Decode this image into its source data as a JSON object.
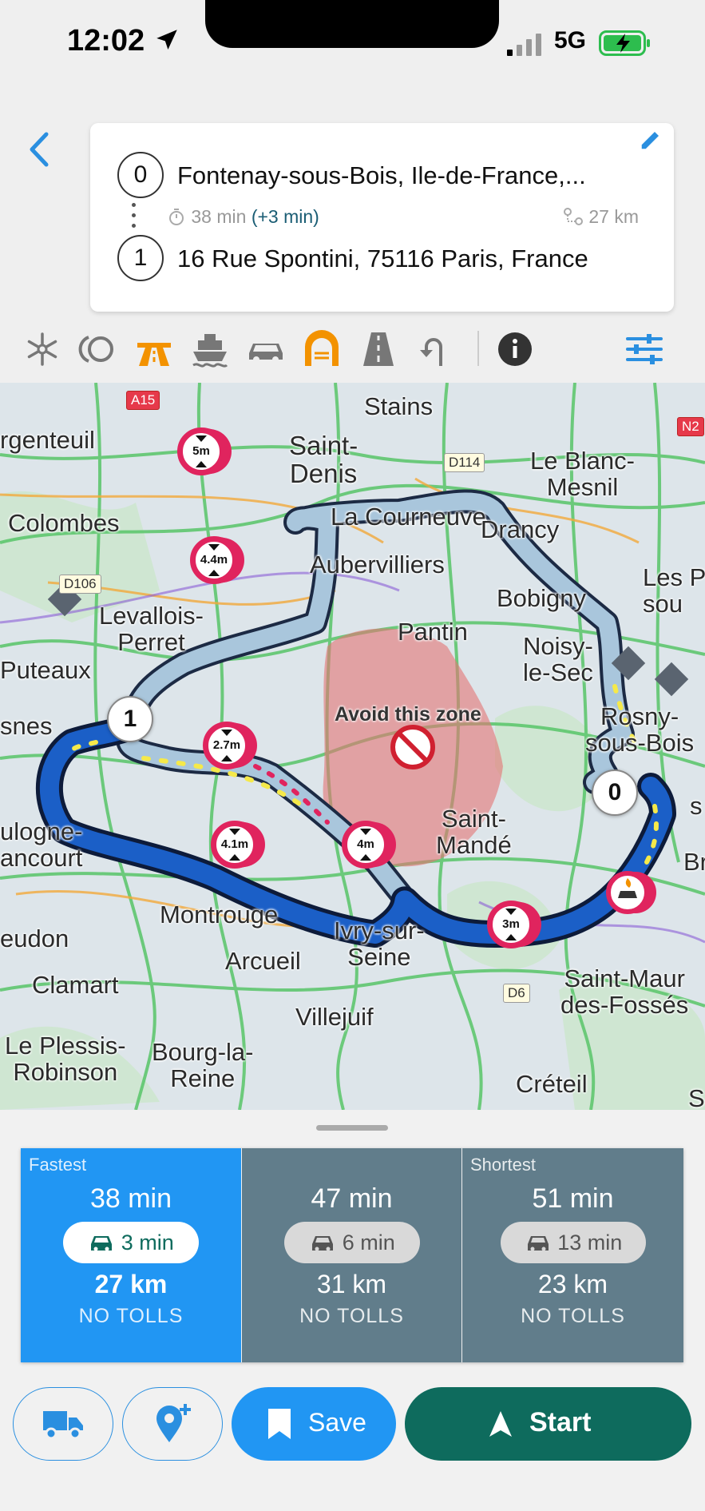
{
  "status_bar": {
    "time": "12:02",
    "network": "5G"
  },
  "directions": {
    "origin": {
      "index": "0",
      "address": "Fontenay-sous-Bois, Ile-de-France,..."
    },
    "destination": {
      "index": "1",
      "address": "16 Rue Spontini, 75116 Paris, France"
    },
    "duration": "38 min",
    "delay": "(+3 min)",
    "distance": "27 km"
  },
  "toolbar": {
    "icons": [
      "snowflake-icon",
      "low-emission-zone-icon",
      "highway-icon",
      "ferry-icon",
      "car-pool-icon",
      "tunnel-icon",
      "road-icon",
      "u-turn-icon",
      "info-icon",
      "settings-sliders-icon"
    ]
  },
  "map": {
    "labels": {
      "stains": "Stains",
      "argenteuil": "rgenteuil",
      "saint_denis": "Saint-\nDenis",
      "le_blanc_mesnil": "Le Blanc-\nMesnil",
      "colombes": "Colombes",
      "la_courneuve": "La Courneuve",
      "drancy": "Drancy",
      "aubervilliers": "Aubervilliers",
      "bobigny": "Bobigny",
      "les_p": "Les P\nsou",
      "levallois": "Levallois-\nPerret",
      "pantin": "Pantin",
      "noisy": "Noisy-\nle-Sec",
      "puteaux": "Puteaux",
      "asnes": "snes",
      "rosny": "Rosny-\nsous-Bois",
      "saint_mande": "Saint-\nMandé",
      "boulogne": "ulogne-\nancourt",
      "montrouge": "Montrouge",
      "ivry": "Ivry-sur-\nSeine",
      "meudon": "eudon",
      "arcueil": "Arcueil",
      "clamart": "Clamart",
      "villejuif": "Villejuif",
      "saint_maur": "Saint-Maur\ndes-Fossés",
      "le_plessis": "Le Plessis-\nRobinson",
      "bourg": "Bourg-la-\nReine",
      "creteil": "Créteil",
      "br": "Br",
      "s_right": "s",
      "s_bottom": "S"
    },
    "road_tags": {
      "a15": "A15",
      "n2": "N2",
      "d114": "D114",
      "d106": "D106",
      "d6": "D6"
    },
    "avoid_zone_label": "Avoid this zone",
    "height_limits": [
      "5m",
      "4.4m",
      "2.7m",
      "4.1m",
      "4m",
      "3m"
    ],
    "markers": {
      "start": "0",
      "end": "1"
    },
    "colors": {
      "route_main": "#1b5fc7",
      "route_alt": "#a9c6dc",
      "avoid_zone": "#e57373"
    }
  },
  "routes": [
    {
      "tag": "Fastest",
      "duration": "38 min",
      "traffic": "3 min",
      "distance": "27 km",
      "tolls": "NO TOLLS",
      "selected": true
    },
    {
      "tag": "",
      "duration": "47 min",
      "traffic": "6 min",
      "distance": "31 km",
      "tolls": "NO TOLLS",
      "selected": false
    },
    {
      "tag": "Shortest",
      "duration": "51 min",
      "traffic": "13 min",
      "distance": "23 km",
      "tolls": "NO TOLLS",
      "selected": false
    }
  ],
  "actions": {
    "save_label": "Save",
    "start_label": "Start"
  },
  "colors": {
    "accent": "#2196f3",
    "unselected_route": "#617d8b",
    "start_button": "#0e6b5d",
    "alert_red": "#e0245e"
  }
}
